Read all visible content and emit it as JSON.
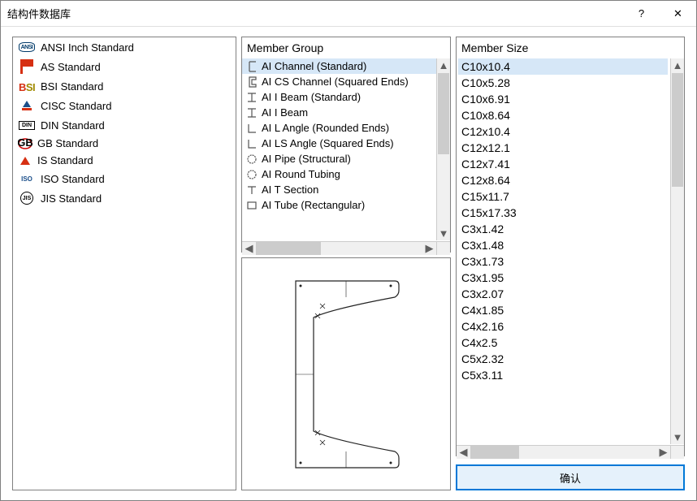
{
  "window": {
    "title": "结构件数据库",
    "help_glyph": "?",
    "close_glyph": "✕"
  },
  "standards": [
    {
      "name": "ANSI Inch Standard",
      "icon": "ansi"
    },
    {
      "name": "AS Standard",
      "icon": "as"
    },
    {
      "name": "BSI Standard",
      "icon": "bsi"
    },
    {
      "name": "CISC Standard",
      "icon": "cisc"
    },
    {
      "name": "DIN Standard",
      "icon": "din"
    },
    {
      "name": "GB Standard",
      "icon": "gb"
    },
    {
      "name": "IS Standard",
      "icon": "is"
    },
    {
      "name": "ISO Standard",
      "icon": "iso"
    },
    {
      "name": "JIS Standard",
      "icon": "jis"
    }
  ],
  "member_group": {
    "header": "Member Group",
    "items": [
      {
        "name": "AI Channel (Standard)",
        "shape": "channel",
        "selected": true
      },
      {
        "name": "AI CS Channel (Squared Ends)",
        "shape": "channel-sq"
      },
      {
        "name": "AI I Beam (Standard)",
        "shape": "ibeam"
      },
      {
        "name": "AI I Beam",
        "shape": "ibeam"
      },
      {
        "name": "AI L Angle (Rounded Ends)",
        "shape": "angle"
      },
      {
        "name": "AI LS Angle (Squared Ends)",
        "shape": "angle"
      },
      {
        "name": "AI Pipe (Structural)",
        "shape": "pipe"
      },
      {
        "name": "AI Round Tubing",
        "shape": "pipe"
      },
      {
        "name": "AI T Section",
        "shape": "tee"
      },
      {
        "name": "AI Tube (Rectangular)",
        "shape": "rect"
      }
    ]
  },
  "member_size": {
    "header": "Member Size",
    "items": [
      "C10x10.4",
      "C10x5.28",
      "C10x6.91",
      "C10x8.64",
      "C12x10.4",
      "C12x12.1",
      "C12x7.41",
      "C12x8.64",
      "C15x11.7",
      "C15x17.33",
      "C3x1.42",
      "C3x1.48",
      "C3x1.73",
      "C3x1.95",
      "C3x2.07",
      "C4x1.85",
      "C4x2.16",
      "C4x2.5",
      "C5x2.32",
      "C5x3.11"
    ],
    "selected": 0
  },
  "ok_button": "确认",
  "glyphs": {
    "up": "▲",
    "down": "▼",
    "left": "◀",
    "right": "▶"
  }
}
